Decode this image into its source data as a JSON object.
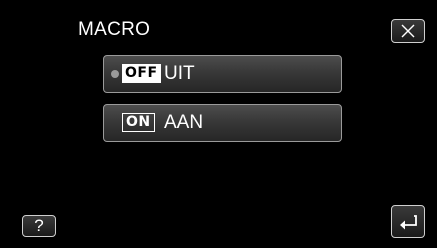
{
  "header": {
    "title": "MACRO",
    "close_icon": "close-icon"
  },
  "options": [
    {
      "badge": "OFF",
      "label": "UIT",
      "selected": true
    },
    {
      "badge": "ON",
      "label": "AAN",
      "selected": false
    }
  ],
  "footer": {
    "help_label": "?",
    "back_icon": "return-arrow-icon"
  }
}
